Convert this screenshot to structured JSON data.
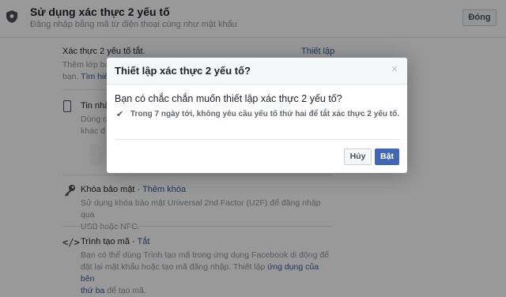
{
  "header": {
    "title": "Sử dụng xác thực 2 yếu tố",
    "subtitle": "Đăng nhập bằng mã từ điện thoại cùng như mật khẩu",
    "close_label": "Đóng"
  },
  "status_section": {
    "status_text": "Xác thực 2 yếu tố tắt.",
    "setup_link": "Thiết lập",
    "desc_line1": "Thêm lớp bả",
    "desc_line2_prefix": "bạn.",
    "desc_link": "Tìm hiể"
  },
  "phone_item": {
    "title": "Tin nhắ",
    "desc_line1": "Dùng c",
    "desc_line2": "khác đ"
  },
  "security_key": {
    "title": "Khóa bảo mật",
    "separator": " · ",
    "action": "Thêm khóa",
    "desc_line1": "Sử dụng khóa bảo mật Universal 2nd Factor (U2F) để đăng nhập qua",
    "desc_line2": "USB hoặc NFC."
  },
  "code_generator": {
    "icon_glyph": "</>",
    "title": "Trình tạo mã",
    "separator": " · ",
    "action": "Tắt",
    "desc_line1": "Bạn có thể dùng Trình tạo mã trong ứng dụng Facebook di động để",
    "desc_line2_prefix": "đặt lại mật khẩu hoặc tạo mã đăng nhập. Thiết lập ",
    "desc_line2_link": "ứng dụng của bên",
    "desc_line3_link": "thứ ba",
    "desc_line3_suffix": " để tạo mã."
  },
  "dialog": {
    "title": "Thiết lập xác thực 2 yếu tố?",
    "close_glyph": "×",
    "question": "Bạn có chắc chắn muốn thiết lập xác thực 2 yếu tố?",
    "check_glyph": "✔",
    "option_text": "Trong 7 ngày tới, không yêu cầu yếu tố thứ hai để tắt xác thực 2 yếu tố.",
    "cancel_label": "Hủy",
    "confirm_label": "Bật"
  },
  "colors": {
    "link": "#365899",
    "primary_button": "#4267b2",
    "overlay": "rgba(0,0,0,0.4)"
  },
  "icons": [
    "shield-icon",
    "phone-icon",
    "key-icon",
    "code-icon",
    "close-icon",
    "checkmark-icon"
  ]
}
